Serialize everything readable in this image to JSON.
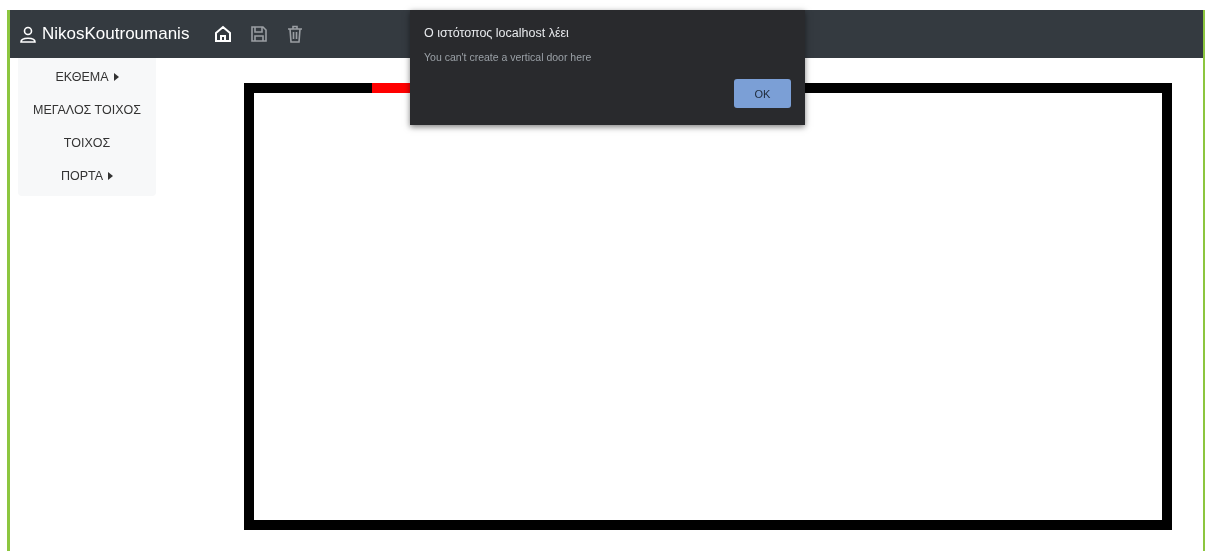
{
  "navbar": {
    "username": "NikosKoutroumanis",
    "tools": [
      {
        "kind": "home",
        "disabled": false
      },
      {
        "kind": "save",
        "disabled": true
      },
      {
        "kind": "trash",
        "disabled": true
      }
    ]
  },
  "sidebar": {
    "items": [
      {
        "label": "ΕΚΘΕΜΑ",
        "has_submenu": true
      },
      {
        "label": "ΜΕΓΑΛΟΣ ΤΟΙΧΟΣ",
        "has_submenu": false
      },
      {
        "label": "ΤΟΙΧΟΣ",
        "has_submenu": false
      },
      {
        "label": "ΠΟΡΤΑ",
        "has_submenu": true
      }
    ]
  },
  "canvas": {
    "kind": "room-plan"
  },
  "dialog": {
    "title": "Ο ιστότοπος localhost λέει",
    "message": "You can't create a vertical door here",
    "buttons": [
      "OK"
    ]
  }
}
